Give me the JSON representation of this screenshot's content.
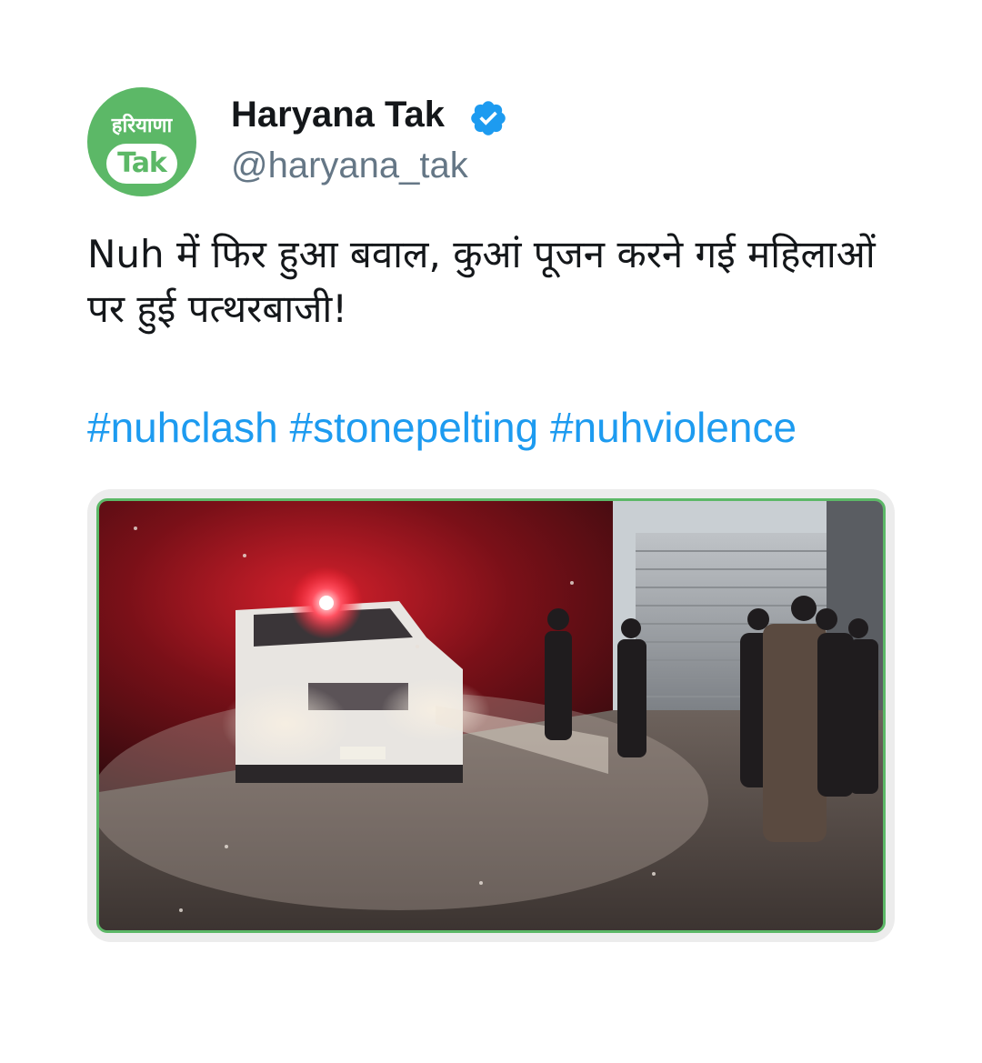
{
  "header": {
    "display_name": "Haryana Tak",
    "handle": "@haryana_tak",
    "verified_icon": "verified-badge-icon",
    "avatar": {
      "logo_line1": "हरियाणा",
      "logo_line2": "Tak",
      "color": "#5cb867"
    }
  },
  "tweet": {
    "text": "Nuh में फिर हुआ बवाल, कुआं पूजन करने गई महिलाओं पर हुई पत्थरबाजी!",
    "hashtags": [
      "#nuhclash",
      "#stonepelting",
      "#nuhviolence"
    ]
  },
  "media": {
    "type": "video-still",
    "description_icon": "video-frame",
    "border_color": "#5cb867"
  },
  "colors": {
    "text": "#14171a",
    "handle": "#657786",
    "link": "#1d9bf0",
    "verified": "#1d9bf0",
    "brand": "#5cb867"
  }
}
